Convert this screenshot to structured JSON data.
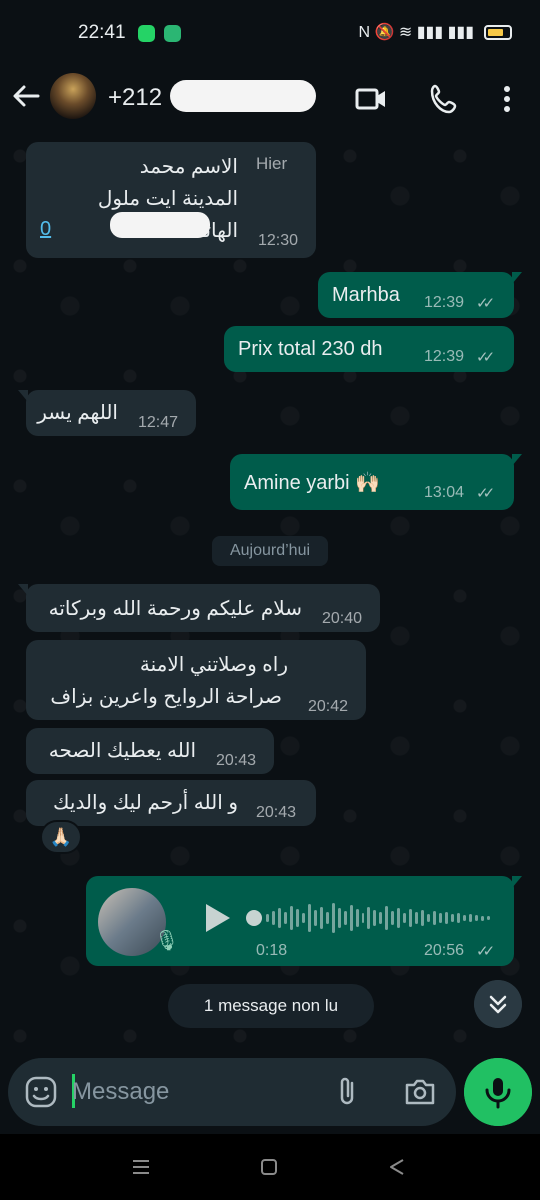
{
  "status_bar": {
    "time": "22:41",
    "right_glyphs": "N 🔕 ≋ ▮▮▮ ▮▮▮"
  },
  "header": {
    "contact_name": "+212",
    "icons": [
      "back-arrow-icon",
      "video-call-icon",
      "voice-call-icon",
      "more-vertical-icon"
    ]
  },
  "chat": {
    "messages": [
      {
        "id": "m1",
        "direction": "in",
        "lines": [
          "الاسم محمد",
          "المدينة ايت ملول",
          "الهاتف"
        ],
        "label": "Hier",
        "time": "12:30"
      },
      {
        "id": "m2",
        "direction": "out",
        "text": "Marhba",
        "time": "12:39",
        "ticks": "✓✓"
      },
      {
        "id": "m3",
        "direction": "out",
        "text": "Prix total 230 dh",
        "time": "12:39",
        "ticks": "✓✓"
      },
      {
        "id": "m4",
        "direction": "in",
        "text": "اللهم يسر",
        "time": "12:47"
      },
      {
        "id": "m5",
        "direction": "out",
        "text": "Amine yarbi 🙌🏻",
        "time": "13:04",
        "ticks": "✓✓"
      },
      {
        "id": "m6",
        "direction": "in",
        "text": "سلام عليكم ورحمة الله وبركاته",
        "time": "20:40"
      },
      {
        "id": "m7",
        "direction": "in",
        "lines": [
          "راه وصلاتني الامنة",
          "صراحة الروايح واعرين بزاف"
        ],
        "time": "20:42"
      },
      {
        "id": "m8",
        "direction": "in",
        "text": "الله يعطيك الصحه",
        "time": "20:43"
      },
      {
        "id": "m9",
        "direction": "in",
        "text": "و الله أرحم ليك والديك",
        "time": "20:43",
        "reaction": "🙏🏻"
      },
      {
        "id": "m10",
        "direction": "out",
        "type": "voice",
        "duration": "0:18",
        "time": "20:56",
        "ticks": "✓✓"
      }
    ],
    "date_separator": "Aujourd’hui",
    "unread_banner": "1 message non lu"
  },
  "composer": {
    "placeholder": "Message",
    "icons": [
      "emoji-icon",
      "attach-icon",
      "camera-icon",
      "mic-icon"
    ]
  },
  "colors": {
    "background": "#0b1014",
    "incoming_bubble": "#202c33",
    "outgoing_bubble": "#005c4b",
    "accent_green": "#21c063",
    "link_blue": "#53bdeb"
  }
}
